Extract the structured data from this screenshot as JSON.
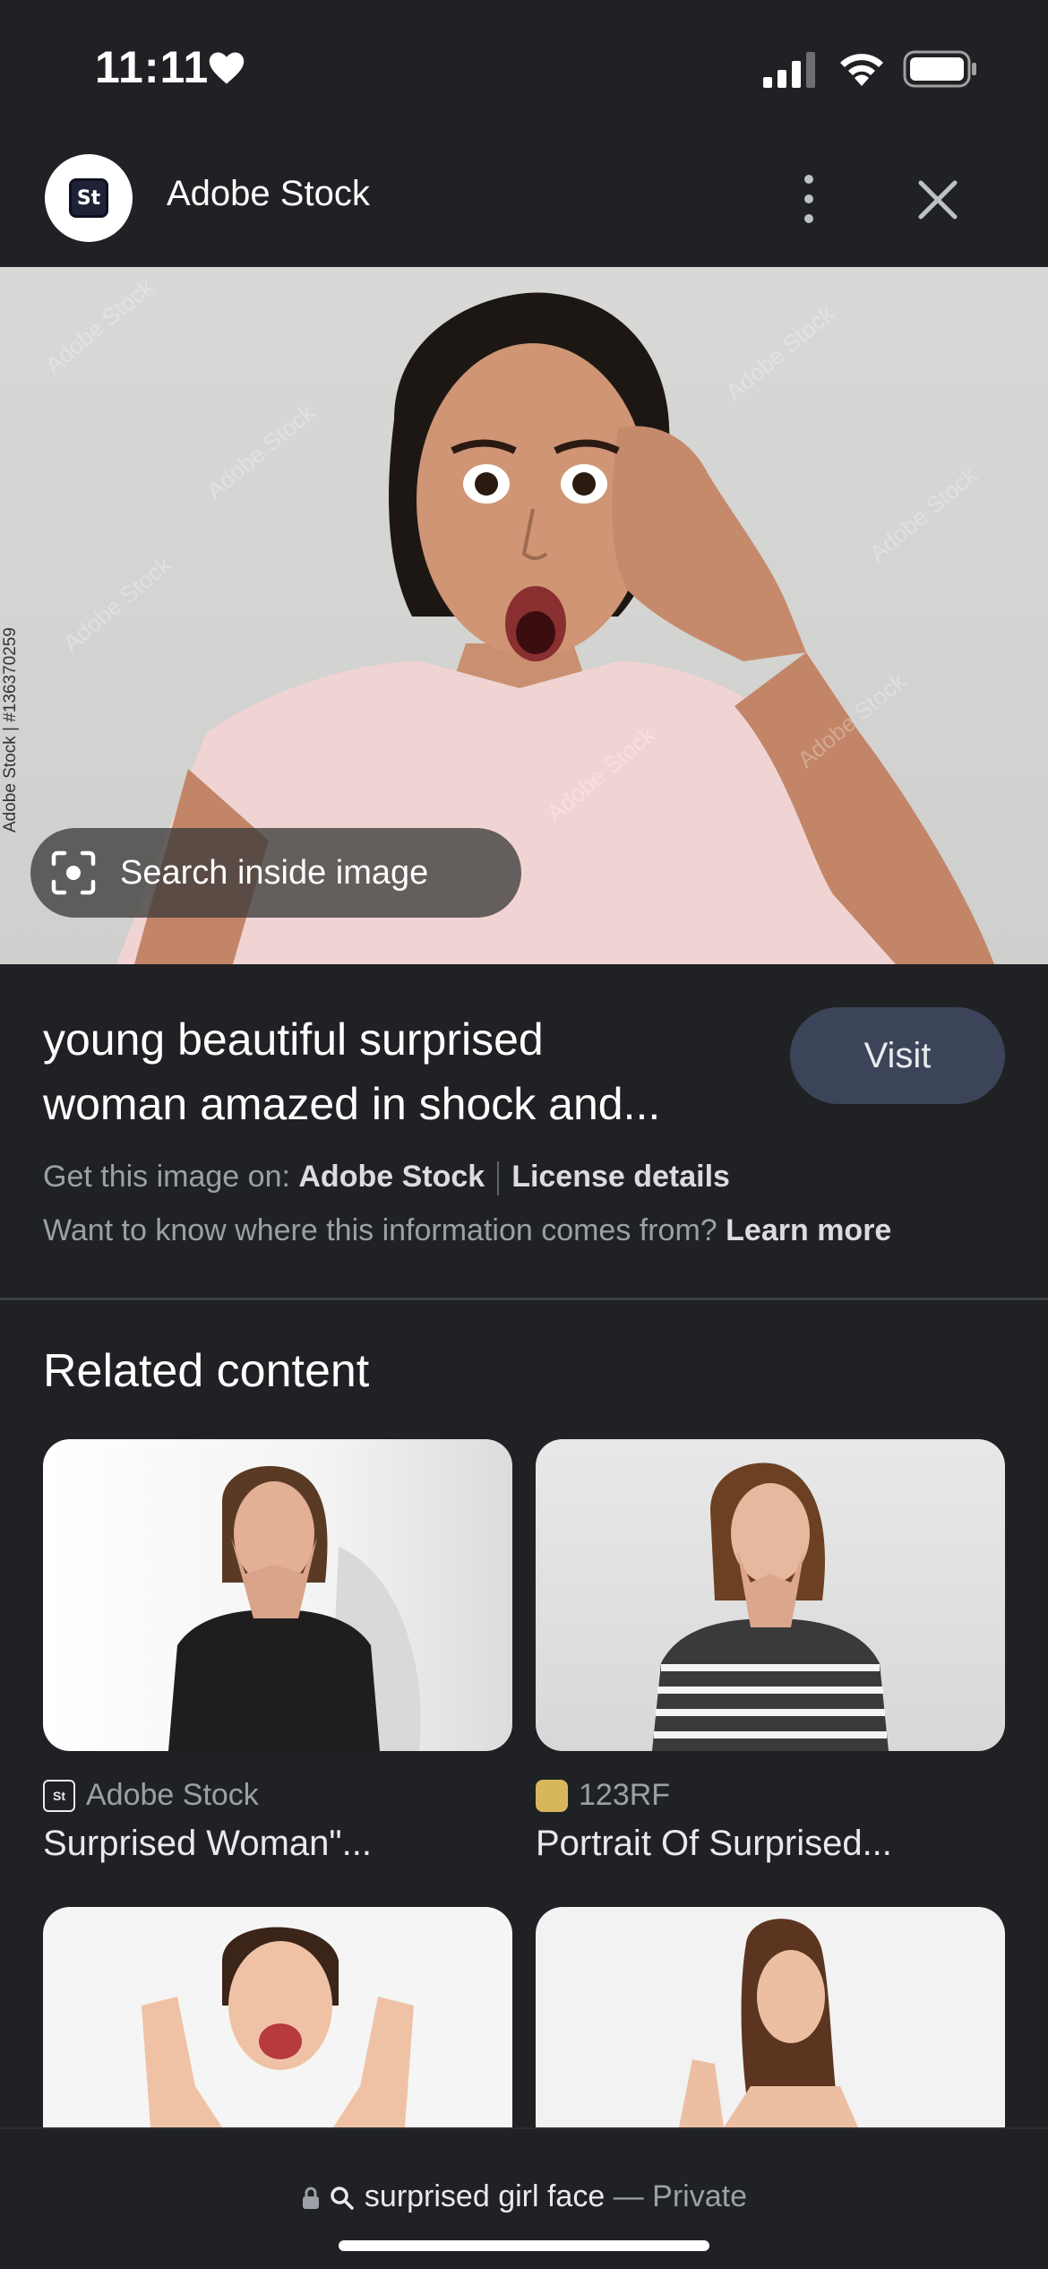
{
  "status_bar": {
    "time": "11:11"
  },
  "header": {
    "source_name": "Adobe Stock",
    "logo_text": "St"
  },
  "image": {
    "lens_label": "Search inside image",
    "watermark_id": "Adobe Stock | #136370259"
  },
  "result": {
    "title_line1": "young beautiful surprised",
    "title_line2": "woman amazed in shock and...",
    "visit_label": "Visit",
    "get_image_prefix": "Get this image on:",
    "get_image_source": "Adobe Stock",
    "license_label": "License details",
    "info_question": "Want to know where this information comes from?",
    "learn_more": "Learn more"
  },
  "related": {
    "heading": "Related content",
    "cards": [
      {
        "source": "Adobe Stock",
        "title": "Surprised Woman\"..."
      },
      {
        "source": "123RF",
        "title": "Portrait Of Surprised..."
      }
    ]
  },
  "bottom_bar": {
    "query": "surprised girl face",
    "separator": "—",
    "mode": "Private"
  },
  "colors": {
    "background": "#202124",
    "visit_button": "#3c4459",
    "muted_text": "#9aa0a6"
  }
}
